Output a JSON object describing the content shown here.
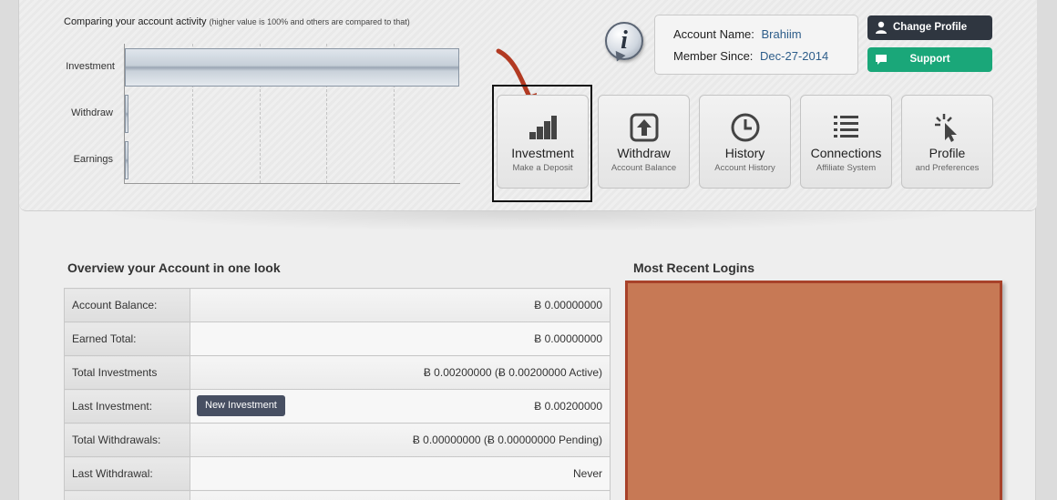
{
  "chart": {
    "title": "Comparing your account activity",
    "subtitle": "(higher value is 100% and others are compared to that)"
  },
  "chart_data": {
    "type": "bar",
    "orientation": "horizontal",
    "categories": [
      "Investment",
      "Withdraw",
      "Earnings"
    ],
    "values": [
      100,
      0,
      0
    ],
    "xlim": [
      0,
      100
    ],
    "grid": true
  },
  "account": {
    "name_label": "Account Name:",
    "name_value": "Brahiim",
    "since_label": "Member Since:",
    "since_value": "Dec-27-2014"
  },
  "buttons": {
    "change_profile": "Change Profile",
    "support": "Support"
  },
  "tiles": [
    {
      "title": "Investment",
      "subtitle": "Make a Deposit",
      "icon": "bar-chart-icon"
    },
    {
      "title": "Withdraw",
      "subtitle": "Account Balance",
      "icon": "upload-arrow-icon"
    },
    {
      "title": "History",
      "subtitle": "Account History",
      "icon": "clock-icon"
    },
    {
      "title": "Connections",
      "subtitle": "Affiliate System",
      "icon": "list-icon"
    },
    {
      "title": "Profile",
      "subtitle": "and Preferences",
      "icon": "cursor-click-icon"
    }
  ],
  "overview": {
    "title": "Overview your Account in one look",
    "rows": [
      {
        "label": "Account Balance:",
        "value": "Ƀ 0.00000000"
      },
      {
        "label": "Earned Total:",
        "value": "Ƀ 0.00000000"
      },
      {
        "label": "Total Investments",
        "value": "Ƀ 0.00200000 (Ƀ 0.00200000 Active)"
      },
      {
        "label": "Last Investment:",
        "value": "Ƀ 0.00200000",
        "button": "New Investment"
      },
      {
        "label": "Total Withdrawals:",
        "value": "Ƀ 0.00000000 (Ƀ 0.00000000 Pending)"
      },
      {
        "label": "Last Withdrawal:",
        "value": "Never"
      },
      {
        "label": "",
        "value": ""
      }
    ]
  },
  "logins": {
    "title": "Most Recent Logins"
  },
  "colors": {
    "support_green": "#1aa779",
    "dark_button": "#2f3640",
    "redacted_fill": "#c77955",
    "redacted_border": "#a8422a",
    "link_blue": "#2d5d8a"
  }
}
